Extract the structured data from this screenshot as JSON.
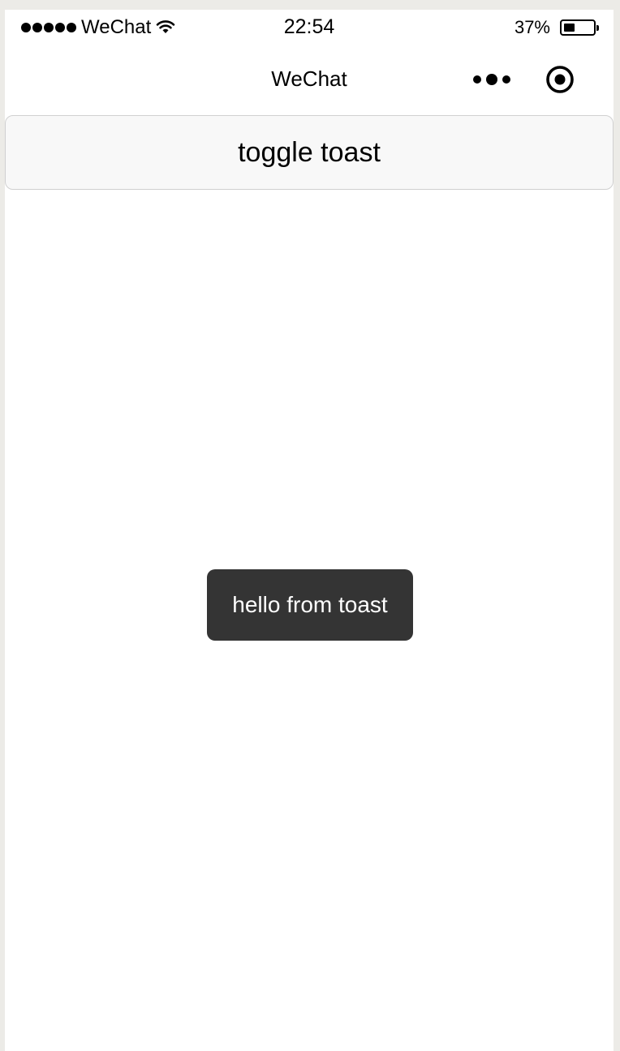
{
  "status_bar": {
    "signal_dots": 5,
    "carrier": "WeChat",
    "wifi_icon": "wifi-icon",
    "time": "22:54",
    "battery_percent_text": "37%",
    "battery_level": 0.37
  },
  "nav_bar": {
    "title": "WeChat",
    "more_icon": "more-dots-icon",
    "close_icon": "record-circle-icon"
  },
  "main": {
    "toggle_button_label": "toggle toast"
  },
  "toast": {
    "message": "hello from toast"
  },
  "colors": {
    "toast_background": "#343434",
    "button_background": "#f8f8f8",
    "page_background": "#ffffff"
  }
}
